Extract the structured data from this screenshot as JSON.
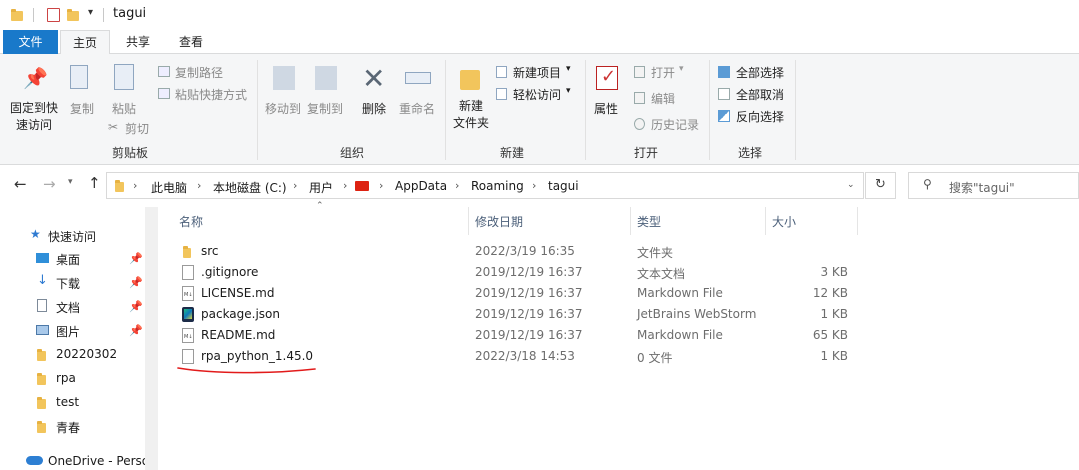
{
  "window": {
    "title": "tagui"
  },
  "tabs": [
    "文件",
    "主页",
    "共享",
    "查看"
  ],
  "ribbon": {
    "clipboard": {
      "pin_quick_access": "固定到快\n速访问",
      "copy": "复制",
      "paste": "粘贴",
      "copy_path": "复制路径",
      "paste_shortcut": "粘贴快捷方式",
      "cut": "剪切",
      "group": "剪贴板"
    },
    "organize": {
      "move_to": "移动到",
      "copy_to": "复制到",
      "delete": "删除",
      "rename": "重命名",
      "group": "组织"
    },
    "new": {
      "new_folder": "新建\n文件夹",
      "new_item": "新建项目",
      "easy_access": "轻松访问",
      "group": "新建"
    },
    "open": {
      "properties": "属性",
      "open": "打开",
      "edit": "编辑",
      "history": "历史记录",
      "group": "打开"
    },
    "select": {
      "select_all": "全部选择",
      "select_none": "全部取消",
      "invert": "反向选择",
      "group": "选择"
    }
  },
  "address": {
    "crumbs": [
      "此电脑",
      "本地磁盘 (C:)",
      "用户",
      "",
      "AppData",
      "Roaming",
      "tagui"
    ],
    "search_placeholder": "搜索\"tagui\""
  },
  "nav": [
    {
      "label": "快速访问",
      "icon": "star-icon",
      "pinned": false
    },
    {
      "label": "桌面",
      "icon": "desktop-icon",
      "pinned": true
    },
    {
      "label": "下载",
      "icon": "download-icon",
      "pinned": true
    },
    {
      "label": "文档",
      "icon": "document-icon",
      "pinned": true
    },
    {
      "label": "图片",
      "icon": "pictures-icon",
      "pinned": true
    },
    {
      "label": "20220302",
      "icon": "folder-icon",
      "pinned": false
    },
    {
      "label": "rpa",
      "icon": "folder-icon",
      "pinned": false
    },
    {
      "label": "test",
      "icon": "folder-icon",
      "pinned": false
    },
    {
      "label": "青春",
      "icon": "folder-icon",
      "pinned": false
    },
    {
      "label": "OneDrive - Perso",
      "icon": "cloud-icon",
      "pinned": false
    }
  ],
  "columns": {
    "name": "名称",
    "date": "修改日期",
    "type": "类型",
    "size": "大小"
  },
  "files": [
    {
      "name": "src",
      "date": "2022/3/19 16:35",
      "type": "文件夹",
      "size": "",
      "icon": "folder-icon"
    },
    {
      "name": ".gitignore",
      "date": "2019/12/19 16:37",
      "type": "文本文档",
      "size": "3 KB",
      "icon": "text-file-icon"
    },
    {
      "name": "LICENSE.md",
      "date": "2019/12/19 16:37",
      "type": "Markdown File",
      "size": "12 KB",
      "icon": "markdown-file-icon"
    },
    {
      "name": "package.json",
      "date": "2019/12/19 16:37",
      "type": "JetBrains WebStorm",
      "size": "1 KB",
      "icon": "webstorm-file-icon"
    },
    {
      "name": "README.md",
      "date": "2019/12/19 16:37",
      "type": "Markdown File",
      "size": "65 KB",
      "icon": "markdown-file-icon"
    },
    {
      "name": "rpa_python_1.45.0",
      "date": "2022/3/18 14:53",
      "type": "0 文件",
      "size": "1 KB",
      "icon": "blank-file-icon"
    }
  ],
  "colors": {
    "accent": "#1979ca",
    "annotation": "#e21b1b",
    "folder": "#f2c55c"
  }
}
